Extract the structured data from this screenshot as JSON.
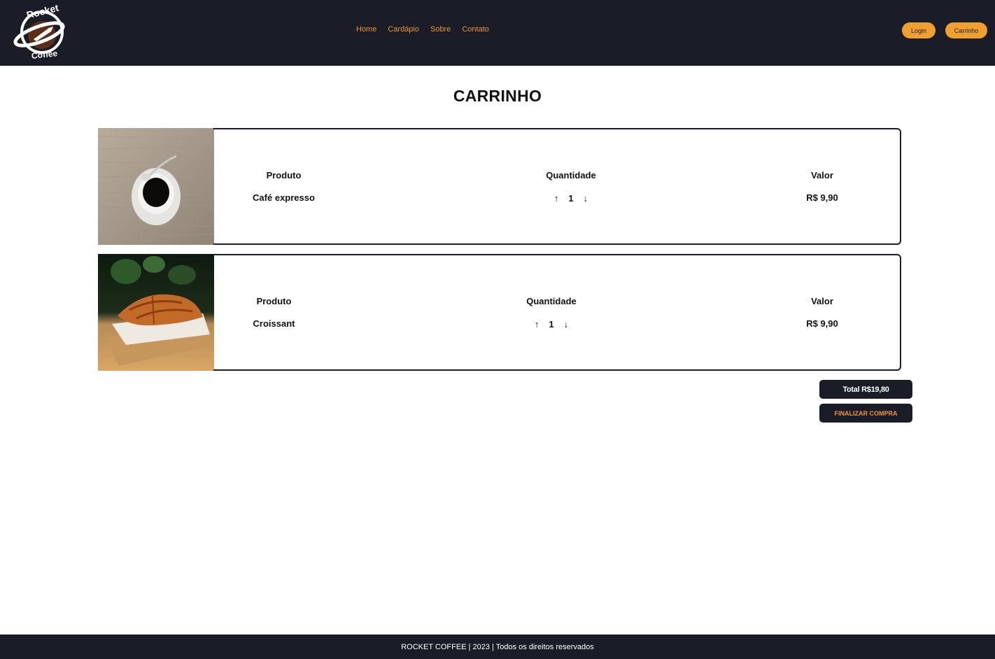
{
  "header": {
    "logo_text_top": "Rocket",
    "logo_text_bottom": "Coffee",
    "nav": [
      "Home",
      "Cardápio",
      "Sobre",
      "Contato"
    ],
    "login_label": "Login",
    "cart_label": "Carrinho"
  },
  "page": {
    "title": "CARRINHO"
  },
  "cart": {
    "items": [
      {
        "product_header": "Produto",
        "quantity_header": "Quantidade",
        "value_header": "Valor",
        "name": "Café expresso",
        "quantity": "1",
        "up_arrow": "↑",
        "down_arrow": "↓",
        "price": "R$ 9,90"
      },
      {
        "product_header": "Produto",
        "quantity_header": "Quantidade",
        "value_header": "Valor",
        "name": "Croissant",
        "quantity": "1",
        "up_arrow": "↑",
        "down_arrow": "↓",
        "price": "R$ 9,90"
      }
    ],
    "total_label": "Total R$19,80",
    "finalize_label": "FINALIZAR COMPRA"
  },
  "footer": {
    "text": "ROCKET COFFEE | 2023 | Todos os direitos reservados"
  },
  "colors": {
    "dark": "#1a1d27",
    "accent": "#f0922d",
    "button": "#f0a030"
  }
}
